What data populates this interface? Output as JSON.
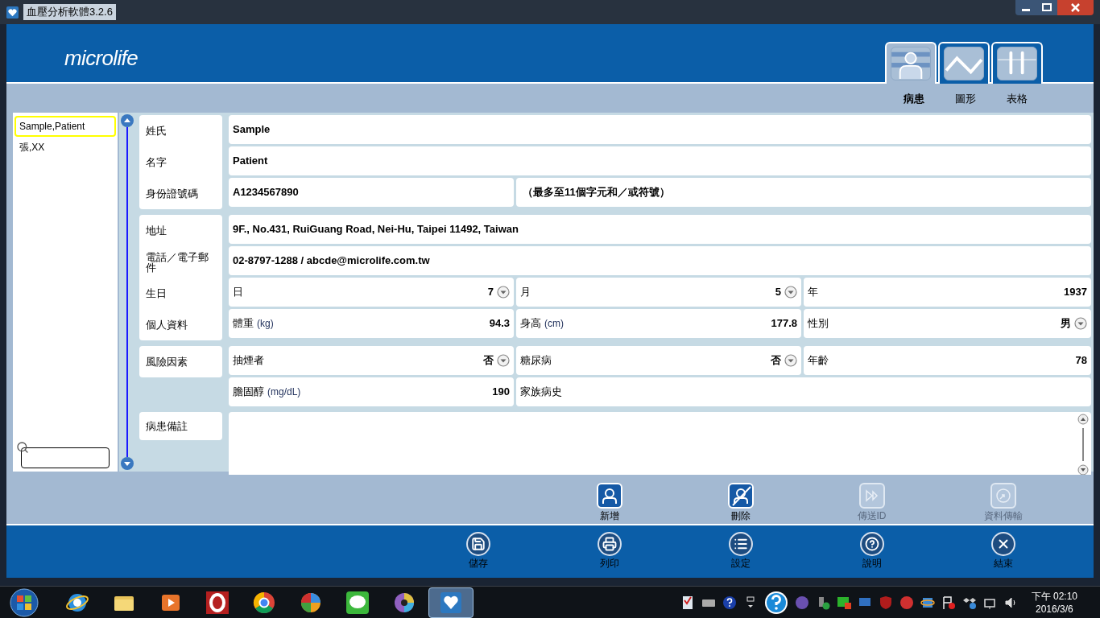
{
  "window": {
    "title": "血壓分析軟體3.2.6"
  },
  "header": {
    "logo": "microlife",
    "tabs": [
      {
        "label": "病患",
        "selected": true,
        "kind": "patient"
      },
      {
        "label": "圖形",
        "selected": false,
        "kind": "chart"
      },
      {
        "label": "表格",
        "selected": false,
        "kind": "table"
      }
    ]
  },
  "patient_list": {
    "items": [
      {
        "name": "Sample,Patient",
        "selected": true
      },
      {
        "name": "張,XX",
        "selected": false
      }
    ]
  },
  "form": {
    "groups": [
      {
        "labels": [
          "姓氏",
          "名字",
          "身份證號碼"
        ],
        "rows": [
          [
            {
              "kind": "value",
              "value": "Sample"
            }
          ],
          [
            {
              "kind": "value",
              "value": "Patient"
            }
          ],
          [
            {
              "kind": "value",
              "value": "A1234567890"
            },
            {
              "kind": "hint",
              "value": "（最多至11個字元和／或符號）"
            }
          ]
        ]
      },
      {
        "labels": [
          "地址",
          "電話／電子郵件",
          "生日",
          "個人資料"
        ],
        "rows": [
          [
            {
              "kind": "value",
              "value": "9F., No.431, RuiGuang Road, Nei-Hu, Taipei 11492, Taiwan"
            }
          ],
          [
            {
              "kind": "value",
              "value": "02-8797-1288 / abcde@microlife.com.tw"
            }
          ],
          [
            {
              "kind": "select",
              "label": "日",
              "value": "7"
            },
            {
              "kind": "select",
              "label": "月",
              "value": "5"
            },
            {
              "kind": "labeled",
              "label": "年",
              "value": "1937"
            }
          ],
          [
            {
              "kind": "labeled",
              "label": "體重",
              "unit": "(kg)",
              "value": "94.3"
            },
            {
              "kind": "labeled",
              "label": "身高",
              "unit": "(cm)",
              "value": "177.8"
            },
            {
              "kind": "select",
              "label": "性別",
              "value": "男"
            }
          ]
        ]
      },
      {
        "labels": [
          "風險因素"
        ],
        "rows": [
          [
            {
              "kind": "select",
              "label": "抽煙者",
              "value": "否"
            },
            {
              "kind": "select",
              "label": "糖尿病",
              "value": "否"
            },
            {
              "kind": "labeled",
              "label": "年齡",
              "value": "78"
            }
          ],
          [
            {
              "kind": "labeled",
              "label": "膽固醇",
              "unit": "(mg/dL)",
              "value": "190"
            },
            {
              "kind": "labeled",
              "label": "家族病史"
            }
          ]
        ]
      }
    ],
    "notes": {
      "label": "病患備註"
    }
  },
  "actions": [
    {
      "label": "新增",
      "kind": "add",
      "disabled": false
    },
    {
      "label": "刪除",
      "kind": "delete",
      "disabled": false
    },
    {
      "label": "傳送ID",
      "kind": "send",
      "disabled": true
    },
    {
      "label": "資料傳輸",
      "kind": "transfer",
      "disabled": true
    }
  ],
  "toolbar": [
    {
      "label": "儲存",
      "kind": "save"
    },
    {
      "label": "列印",
      "kind": "print"
    },
    {
      "label": "設定",
      "kind": "settings"
    },
    {
      "label": "說明",
      "kind": "help"
    },
    {
      "label": "結束",
      "kind": "exit"
    }
  ],
  "taskbar": {
    "apps": [
      {
        "kind": "ie",
        "selected": false
      },
      {
        "kind": "folder",
        "selected": false
      },
      {
        "kind": "media",
        "selected": false
      },
      {
        "kind": "opera",
        "selected": false
      },
      {
        "kind": "chrome",
        "selected": false
      },
      {
        "kind": "pinwheel",
        "selected": false
      },
      {
        "kind": "chat",
        "selected": false
      },
      {
        "kind": "wheel",
        "selected": false
      },
      {
        "kind": "heart",
        "selected": true
      }
    ],
    "clock": {
      "time": "下午 02:10",
      "date": "2016/3/6"
    }
  }
}
